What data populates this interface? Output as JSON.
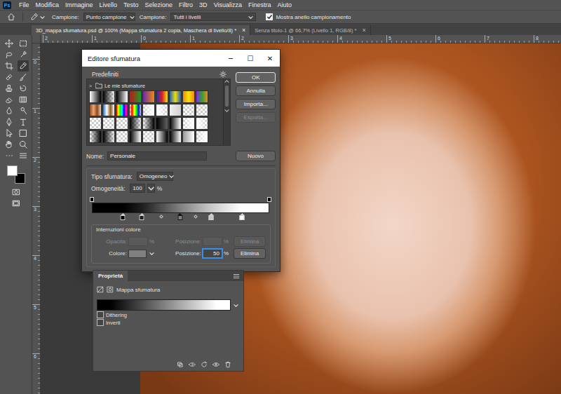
{
  "app": {
    "logo": "Ps"
  },
  "menu": [
    "File",
    "Modifica",
    "Immagine",
    "Livello",
    "Testo",
    "Selezione",
    "Filtro",
    "3D",
    "Visualizza",
    "Finestra",
    "Aiuto"
  ],
  "options_bar": {
    "sample_size": {
      "label": "Campione:",
      "value": "Punto campione"
    },
    "sample": {
      "label": "Campione:",
      "value": "Tutti i livelli"
    },
    "show_ring": {
      "label": "Mostra anello campionamento",
      "checked": true
    }
  },
  "doc_tabs": [
    {
      "label": "3D_mappa sfumatura.psd @ 100% (Mappa sfumatura 2 copia, Maschera di livello/8) *",
      "close": "×",
      "selected": true
    },
    {
      "label": "Senza titolo-1 @ 66,7% (Livello 1, RGB/8) *",
      "close": "×",
      "selected": false
    }
  ],
  "rulers": {
    "top": [
      "2",
      "1",
      "0",
      "1",
      "2",
      "3",
      "4",
      "5",
      "6",
      "7",
      "8"
    ],
    "left": [
      "0",
      "1",
      "2",
      "3",
      "4",
      "5",
      "6"
    ]
  },
  "toolbar": {
    "tools": [
      {
        "selected": false
      },
      {
        "selected": false
      },
      {
        "selected": false
      },
      {
        "selected": false
      },
      {
        "selected": false
      },
      {
        "selected": true
      },
      {
        "selected": false
      },
      {
        "selected": false
      },
      {
        "selected": false
      },
      {
        "selected": false
      },
      {
        "selected": false
      },
      {
        "selected": false
      },
      {
        "selected": false
      },
      {
        "selected": false
      },
      {
        "selected": false
      },
      {
        "selected": false
      },
      {
        "selected": false
      },
      {
        "selected": false
      },
      {
        "selected": false
      },
      {
        "selected": false
      },
      {
        "selected": false
      },
      {
        "selected": false
      },
      {
        "selected": false
      },
      {
        "selected": false
      }
    ],
    "foreground": "#ffffff",
    "background": "#000000"
  },
  "gradient_editor": {
    "title": "Editore sfumatura",
    "controls": [
      "─",
      "☐",
      "✕"
    ],
    "presets": {
      "label": "Predefiniti",
      "folder": {
        "expand": ">",
        "name": "Le mie sfumature"
      },
      "swatches": [
        {
          "colors": [
            "#ffffff",
            "#000000"
          ]
        },
        {
          "colors": [
            "#000000",
            "#00000000"
          ]
        },
        {
          "colors": [
            "#000000",
            "#ffffff"
          ]
        },
        {
          "colors": [
            "#d01010",
            "#10a030"
          ]
        },
        {
          "colors": [
            "#6a2aa8",
            "#f08a10"
          ]
        },
        {
          "colors": [
            "#1f2fbf",
            "#d81f1f",
            "#f4e21a"
          ]
        },
        {
          "colors": [
            "#1565c0",
            "#f5d90a",
            "#1565c0"
          ]
        },
        {
          "colors": [
            "#f08a10",
            "#f5e50a",
            "#f08a10"
          ]
        },
        {
          "colors": [
            "#8a2be2",
            "#2e9e3a",
            "#f08a10"
          ]
        },
        {
          "colors": [
            "#8a4a20",
            "#f0a070",
            "#8a4a20",
            "#f3d0b0"
          ]
        },
        {
          "colors": [
            "#1e6fd8",
            "#ffffff",
            "#8a5a20",
            "#ffffff"
          ]
        },
        {
          "colors": [
            "#ff0000",
            "#ffff00",
            "#00ff00",
            "#00ffff",
            "#0000ff",
            "#ff00ff",
            "#ff0000"
          ]
        },
        {
          "colors": [
            "#ff000000",
            "#ff0000",
            "#ffff00",
            "#00ff00",
            "#0000ff",
            "#ff00ff00"
          ]
        },
        {
          "colors": [
            "#ffffff00",
            "#ffffff"
          ]
        },
        {
          "colors": [
            "#ffffff",
            "#ffffff00"
          ]
        },
        {
          "colors": [
            "#f0f0f0",
            "#d0d0d0"
          ]
        },
        {
          "colors": [
            "#ffffff00",
            "#ffffff00"
          ]
        },
        {
          "colors": [
            "#ffffff00",
            "#ffffff00"
          ]
        },
        {
          "colors": [
            "#ffffff00",
            "#00000000"
          ]
        },
        {
          "colors": [
            "#ffffff00",
            "#ffffff00"
          ]
        },
        {
          "colors": [
            "#00000000",
            "#ffffff00"
          ]
        },
        {
          "colors": [
            "#000000",
            "#00000000"
          ]
        },
        {
          "colors": [
            "#00000000",
            "#000000"
          ]
        },
        {
          "colors": [
            "#000000",
            "#606060"
          ]
        },
        {
          "colors": [
            "#000000",
            "#ffffff"
          ]
        },
        {
          "colors": [
            "#00000000",
            "#ffffff"
          ]
        },
        {
          "colors": [
            "#ffffff",
            "#00000000"
          ]
        },
        {
          "colors": [
            "#ffffff00",
            "#000000"
          ]
        },
        {
          "colors": [
            "#000000",
            "#ffffff00"
          ]
        },
        {
          "colors": [
            "#ffffff00",
            "#ffffff00"
          ]
        },
        {
          "colors": [
            "#000000",
            "#ffffff"
          ]
        },
        {
          "colors": [
            "#ffffff00",
            "#ffffff00"
          ]
        },
        {
          "colors": [
            "#ffffff",
            "#000000"
          ]
        },
        {
          "colors": [
            "#000000",
            "#ffffff"
          ]
        },
        {
          "colors": [
            "#9a9a9a",
            "#ffffff"
          ]
        },
        {
          "colors": [
            "#ffffff00",
            "#ffffff"
          ]
        }
      ]
    },
    "buttons": [
      {
        "label": "OK",
        "primary": true,
        "disabled": false
      },
      {
        "label": "Annulla",
        "primary": false,
        "disabled": false
      },
      {
        "label": "Importa...",
        "primary": false,
        "disabled": false
      },
      {
        "label": "Esporta...",
        "primary": false,
        "disabled": true
      }
    ],
    "name": {
      "label": "Nome:",
      "value": "Personale",
      "button": "Nuovo"
    },
    "type": {
      "label": "Tipo sfumatura:",
      "value": "Omogeneo"
    },
    "smoothness": {
      "label": "Omogeneità:",
      "value": "100",
      "unit": "%"
    },
    "opacity_stops": [
      {
        "position": 0,
        "color": "#000000"
      },
      {
        "position": 1,
        "color": "#000000"
      }
    ],
    "color_stops": [
      {
        "position": 0.174,
        "color": "#000000",
        "selected": false
      },
      {
        "position": 0.281,
        "color": "#1e1e1e",
        "selected": false
      },
      {
        "position": 0.498,
        "color": "#808080",
        "selected": true
      },
      {
        "position": 0.672,
        "color": "#c8c8c8",
        "selected": false
      },
      {
        "position": 0.846,
        "color": "#ffffff",
        "selected": false
      }
    ],
    "midpoints": [
      0.391,
      0.585
    ],
    "stops_group": {
      "title": "Interruzioni colore",
      "opacity": {
        "label": "Opacità:",
        "value": "",
        "unit": "%",
        "disabled": true
      },
      "opacity_position": {
        "label": "Posizione:",
        "value": "",
        "unit": "%",
        "disabled": true
      },
      "opacity_delete": {
        "label": "Elimina",
        "disabled": true
      },
      "color": {
        "label": "Colore:",
        "value": "#808080"
      },
      "position": {
        "label": "Posizione:",
        "value": "50",
        "unit": "%",
        "focused": true
      },
      "delete": {
        "label": "Elimina",
        "disabled": false
      }
    }
  },
  "properties": {
    "tab": "Proprietà",
    "title": "Mappa sfumatura",
    "gradient": [
      {
        "position": 0,
        "color": "#000000"
      },
      {
        "position": 0.1,
        "color": "#000000"
      },
      {
        "position": 0.5,
        "color": "#808080"
      },
      {
        "position": 0.9,
        "color": "#ffffff"
      },
      {
        "position": 1,
        "color": "#ffffff"
      }
    ],
    "options": [
      {
        "label": "Dithering",
        "checked": false
      },
      {
        "label": "Inverti",
        "checked": false
      }
    ]
  }
}
